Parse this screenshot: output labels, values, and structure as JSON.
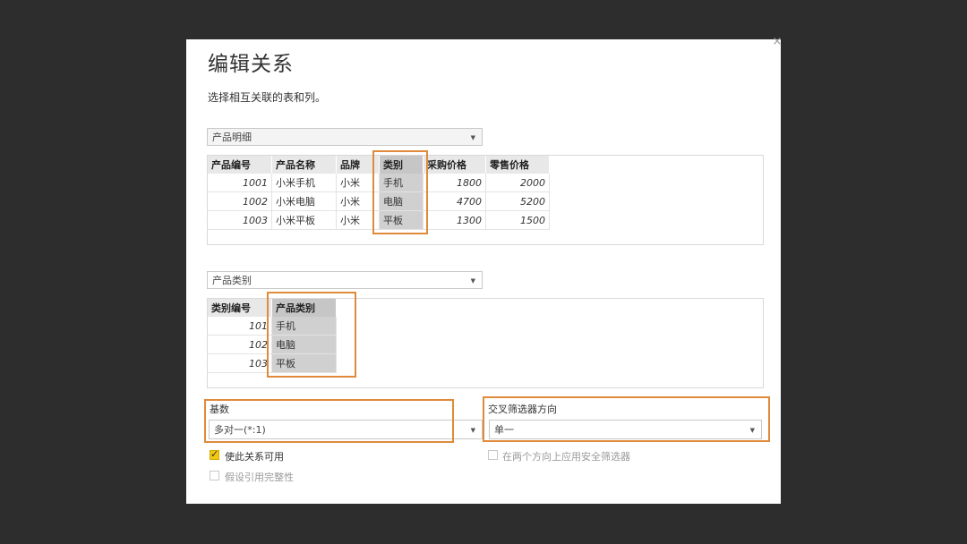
{
  "dialog": {
    "title": "编辑关系",
    "subtitle": "选择相互关联的表和列。",
    "close_glyph": "×"
  },
  "table1": {
    "select_value": "产品明细",
    "columns": [
      "产品编号",
      "产品名称",
      "品牌",
      "类别",
      "采购价格",
      "零售价格"
    ],
    "rows": [
      [
        "1001",
        "小米手机",
        "小米",
        "手机",
        "1800",
        "2000"
      ],
      [
        "1002",
        "小米电脑",
        "小米",
        "电脑",
        "4700",
        "5200"
      ],
      [
        "1003",
        "小米平板",
        "小米",
        "平板",
        "1300",
        "1500"
      ]
    ],
    "selected_column": "类别"
  },
  "table2": {
    "select_value": "产品类别",
    "columns": [
      "类别编号",
      "产品类别"
    ],
    "rows": [
      [
        "101",
        "手机"
      ],
      [
        "102",
        "电脑"
      ],
      [
        "103",
        "平板"
      ]
    ],
    "selected_column": "产品类别"
  },
  "cardinality": {
    "label": "基数",
    "value": "多对一(*:1)"
  },
  "cross_filter": {
    "label": "交叉筛选器方向",
    "value": "单一"
  },
  "options": {
    "activate_label": "使此关系可用",
    "activate_checked": true,
    "referential_label": "假设引用完整性",
    "referential_checked": false,
    "security_filter_label": "在两个方向上应用安全筛选器",
    "security_filter_checked": false
  },
  "colors": {
    "highlight": "#e08a3c",
    "checkbox_checked": "#f2c811",
    "backdrop": "#2d2d2d"
  }
}
